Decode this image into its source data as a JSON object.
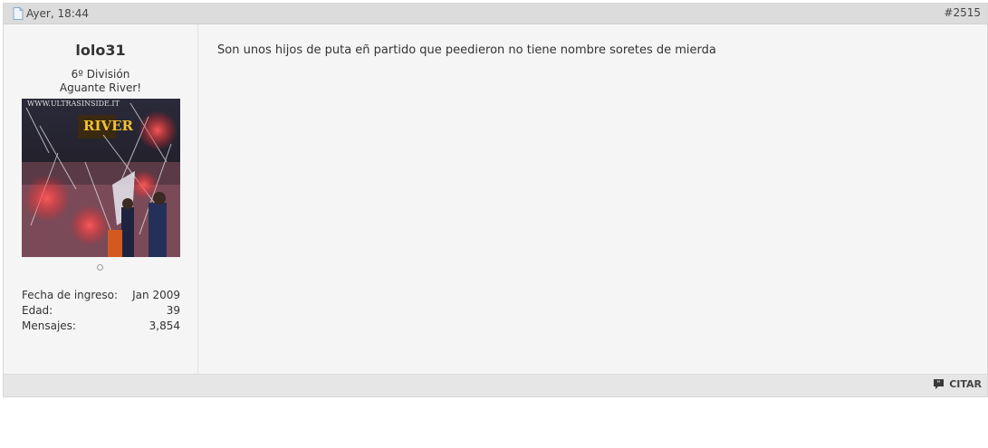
{
  "post": {
    "date": "Ayer, 18:44",
    "number": "#2515",
    "date_icon": "document-icon"
  },
  "user": {
    "name": "lolo31",
    "title_line1": "6º División",
    "title_line2": "Aguante River!",
    "avatar_watermark": "WWW.ULTRASINSIDE.IT",
    "avatar_banner": "RIVER",
    "online_status": "offline",
    "stats": [
      {
        "label": "Fecha de ingreso:",
        "value": "Jan 2009"
      },
      {
        "label": "Edad:",
        "value": "39"
      },
      {
        "label": "Mensajes:",
        "value": "3,854"
      }
    ]
  },
  "message": {
    "text": "Son unos hijos de puta eñ partido que peedieron no tiene nombre soretes de mierda"
  },
  "footer": {
    "quote_label": "CITAR",
    "quote_icon": "quote-bubble-icon"
  }
}
